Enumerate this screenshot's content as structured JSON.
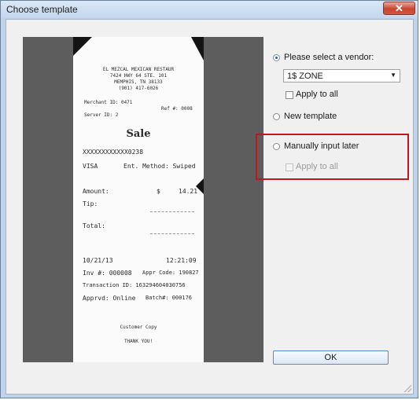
{
  "window": {
    "title": "Choose template",
    "close_label": "✕"
  },
  "receipt": {
    "header_line1": "EL MEZCAL MEXICAN RESTAUR",
    "header_line2": "7424 HWY 64 STE. 101",
    "header_line3": "MEMPHIS, TN 38133",
    "header_line4": "(901) 417-6026",
    "merchant": "Merchant ID: 0471",
    "ref": "Ref #: 0008",
    "server": "Server ID: 2",
    "sale": "Sale",
    "card_number": "XXXXXXXXXXXX0238",
    "card_type": "VISA",
    "entry_method": "Ent. Method: Swiped",
    "amount_label": "Amount:",
    "amount_currency": "$",
    "amount_value": "14.21",
    "tip_label": "Tip:",
    "total_label": "Total:",
    "date": "10/21/13",
    "time": "12:21:09",
    "inv": "Inv #: 000008",
    "appr_code": "Appr Code: 190827",
    "transaction": "Transaction ID: 163294604030756",
    "apprvd": "Apprvd: Online",
    "batch": "Batch#: 000176",
    "customer_copy": "Customer Copy",
    "thank_you": "THANK YOU!"
  },
  "options": {
    "select_vendor_label": "Please select a vendor:",
    "vendor_value": "1$ ZONE",
    "apply_to_all_1": "Apply to all",
    "new_template_label": "New template",
    "manually_input_label": "Manually input later",
    "apply_to_all_2": "Apply to all"
  },
  "buttons": {
    "ok_label": "OK"
  },
  "colors": {
    "highlight": "#c0161d",
    "accent": "#1b5fb8"
  }
}
